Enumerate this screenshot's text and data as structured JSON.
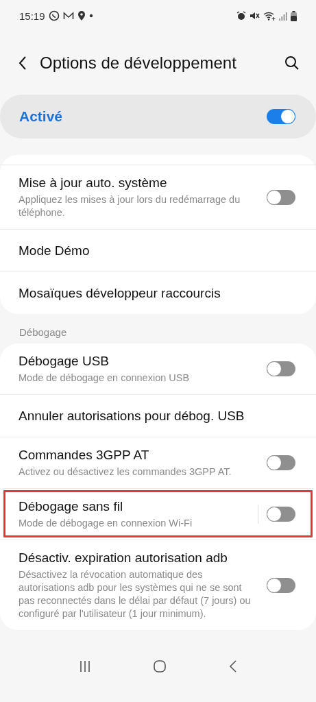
{
  "status_bar": {
    "time": "15:19"
  },
  "header": {
    "title": "Options de développement"
  },
  "master_switch": {
    "label": "Activé",
    "on": true
  },
  "groups": [
    {
      "items": [
        {
          "title": "Mise à jour auto. système",
          "subtitle": "Appliquez les mises à jour lors du redémarrage du téléphone.",
          "kind": "toggle",
          "on": false,
          "highlighted": false
        },
        {
          "title": "Mode Démo",
          "kind": "plain",
          "highlighted": false
        },
        {
          "title": "Mosaïques développeur raccourcis",
          "kind": "plain",
          "highlighted": false
        }
      ]
    },
    {
      "heading": "Débogage",
      "items": [
        {
          "title": "Débogage USB",
          "subtitle": "Mode de débogage en connexion USB",
          "kind": "toggle",
          "on": false,
          "highlighted": false
        },
        {
          "title": "Annuler autorisations pour débog. USB",
          "kind": "plain",
          "highlighted": false
        },
        {
          "title": "Commandes 3GPP AT",
          "subtitle": "Activez ou désactivez les commandes 3GPP AT.",
          "kind": "toggle",
          "on": false,
          "highlighted": false
        },
        {
          "title": "Débogage sans fil",
          "subtitle": "Mode de débogage en connexion Wi-Fi",
          "kind": "split-toggle",
          "on": false,
          "highlighted": true
        },
        {
          "title": "Désactiv. expiration autorisation adb",
          "subtitle": "Désactivez la révocation automatique des autorisations adb pour les systèmes qui ne se sont pas reconnectés dans le délai par défaut (7 jours) ou configuré par l'utilisateur (1 jour minimum).",
          "kind": "toggle",
          "on": false,
          "highlighted": false
        }
      ]
    }
  ]
}
